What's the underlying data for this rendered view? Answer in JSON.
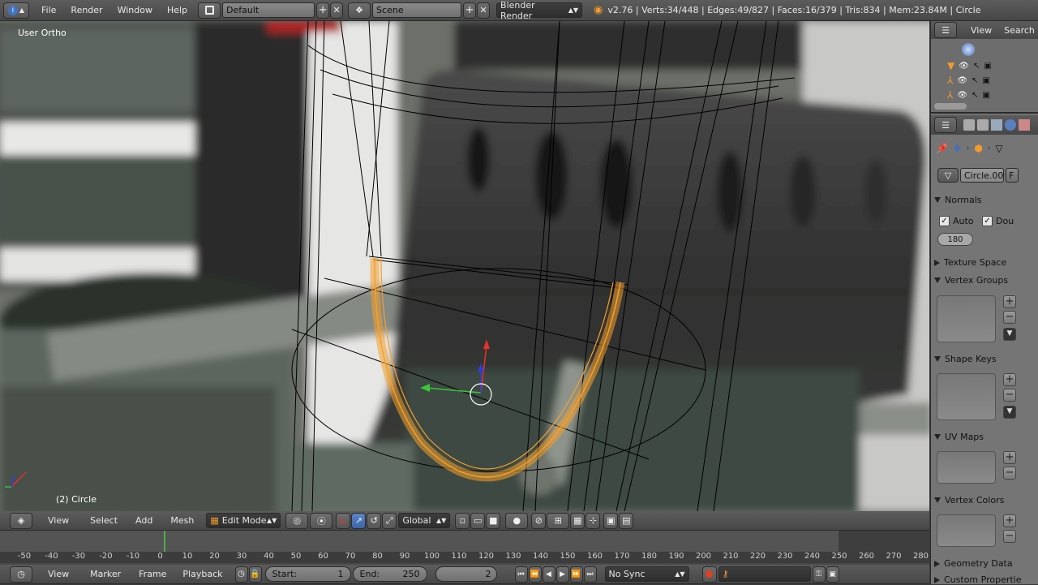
{
  "topbar": {
    "menus": [
      "File",
      "Render",
      "Window",
      "Help"
    ],
    "layout": "Default",
    "scene": "Scene",
    "engine": "Blender Render",
    "stats": "v2.76 | Verts:34/448 | Edges:49/827 | Faces:16/379 | Tris:834 | Mem:23.84M | Circle"
  },
  "viewport": {
    "view_name": "User Ortho",
    "object_label": "(2) Circle"
  },
  "outliner": {
    "menus": [
      "View",
      "Search"
    ]
  },
  "properties": {
    "mesh_name": "Circle.00",
    "fake_user": "F",
    "panels": {
      "normals": "Normals",
      "auto": "Auto",
      "double": "Dou",
      "angle": "180",
      "texture_space": "Texture Space",
      "vertex_groups": "Vertex Groups",
      "shape_keys": "Shape Keys",
      "uv_maps": "UV Maps",
      "vertex_colors": "Vertex Colors",
      "geometry_data": "Geometry Data",
      "custom_props": "Custom Propertie"
    }
  },
  "header3d": {
    "menus": [
      "View",
      "Select",
      "Add",
      "Mesh"
    ],
    "mode": "Edit Mode",
    "orientation": "Global"
  },
  "timeline": {
    "ticks": [
      "-50",
      "-40",
      "-30",
      "-20",
      "-10",
      "0",
      "10",
      "20",
      "30",
      "40",
      "50",
      "60",
      "70",
      "80",
      "90",
      "100",
      "110",
      "120",
      "130",
      "140",
      "150",
      "160",
      "170",
      "180",
      "190",
      "200",
      "210",
      "220",
      "230",
      "240",
      "250",
      "260",
      "270",
      "280"
    ],
    "current_frame_marker": "2"
  },
  "timeline_header": {
    "menus": [
      "View",
      "Marker",
      "Frame",
      "Playback"
    ],
    "start_label": "Start:",
    "start_value": "1",
    "end_label": "End:",
    "end_value": "250",
    "current": "2",
    "sync": "No Sync"
  },
  "colors": {
    "selection": "#f5a02a",
    "wire": "#000000",
    "x_axis": "#e8302a",
    "y_axis": "#38c838",
    "z_axis": "#2a40e0"
  }
}
